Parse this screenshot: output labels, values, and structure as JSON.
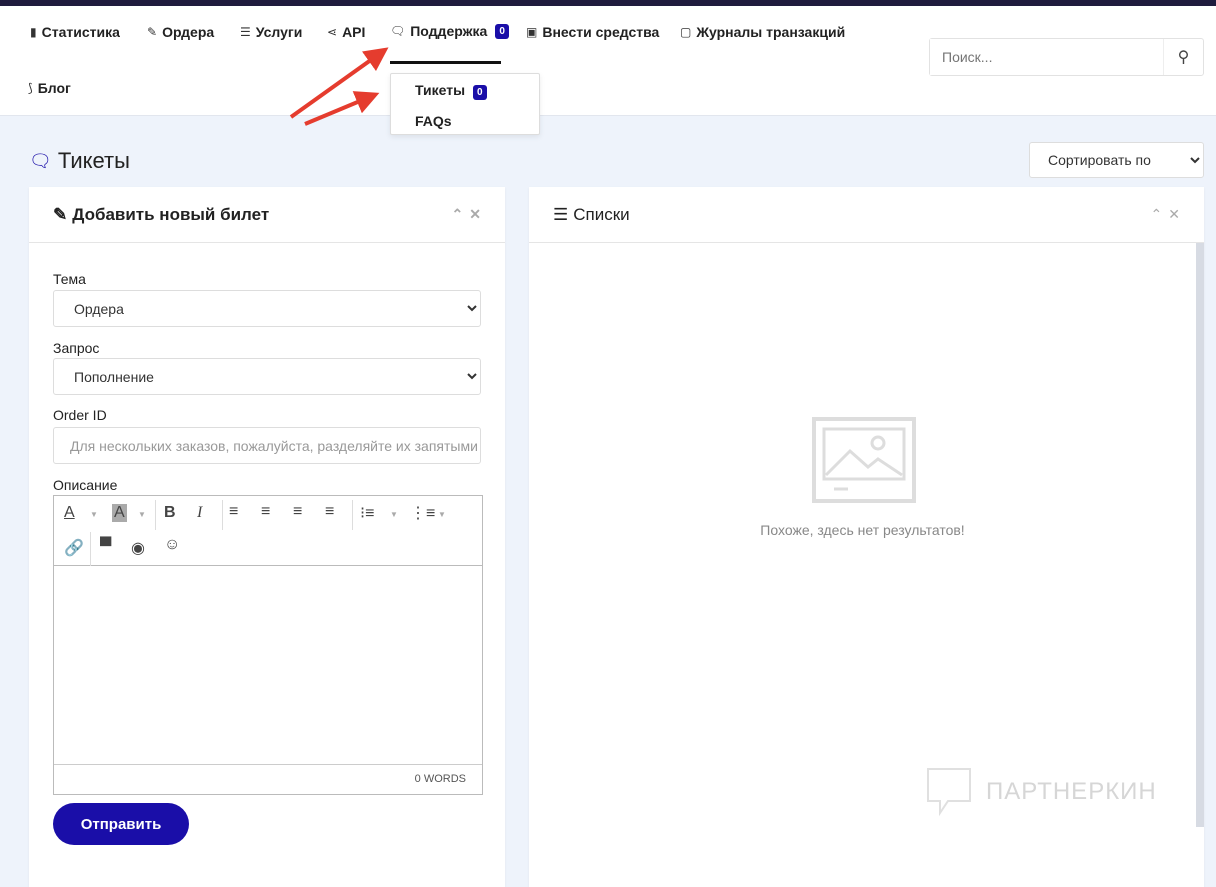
{
  "nav": {
    "items": [
      {
        "label": "Статистика",
        "icon": "bar-chart-icon"
      },
      {
        "label": "Ордера",
        "icon": "edit-icon"
      },
      {
        "label": "Услуги",
        "icon": "list-icon"
      },
      {
        "label": "API",
        "icon": "share-icon"
      },
      {
        "label": "Поддержка",
        "icon": "chat-icon",
        "badge": "0"
      },
      {
        "label": "Внести средства",
        "icon": "money-icon"
      },
      {
        "label": "Журналы транзакций",
        "icon": "calendar-icon"
      },
      {
        "label": "Блог",
        "icon": "rss-icon"
      }
    ],
    "dropdown": [
      {
        "label": "Тикеты",
        "badge": "0"
      },
      {
        "label": "FAQs"
      }
    ]
  },
  "search": {
    "placeholder": "Поиск..."
  },
  "page": {
    "title": "Тикеты",
    "sort_label": "Сортировать по"
  },
  "form": {
    "title": "Добавить новый билет",
    "subject_label": "Тема",
    "subject_value": "Ордера",
    "request_label": "Запрос",
    "request_value": "Пополнение",
    "order_label": "Order ID",
    "order_placeholder": "Для нескольких заказов, пожалуйста, разделяйте их запятыми",
    "desc_label": "Описание",
    "word_count": "0 WORDS",
    "submit": "Отправить"
  },
  "list": {
    "title": "Списки",
    "empty": "Похоже, здесь нет результатов!"
  },
  "watermark": "ПАРТНЕРКИН",
  "colors": {
    "accent": "#1a0ea8",
    "arrow": "#e53c2e"
  }
}
